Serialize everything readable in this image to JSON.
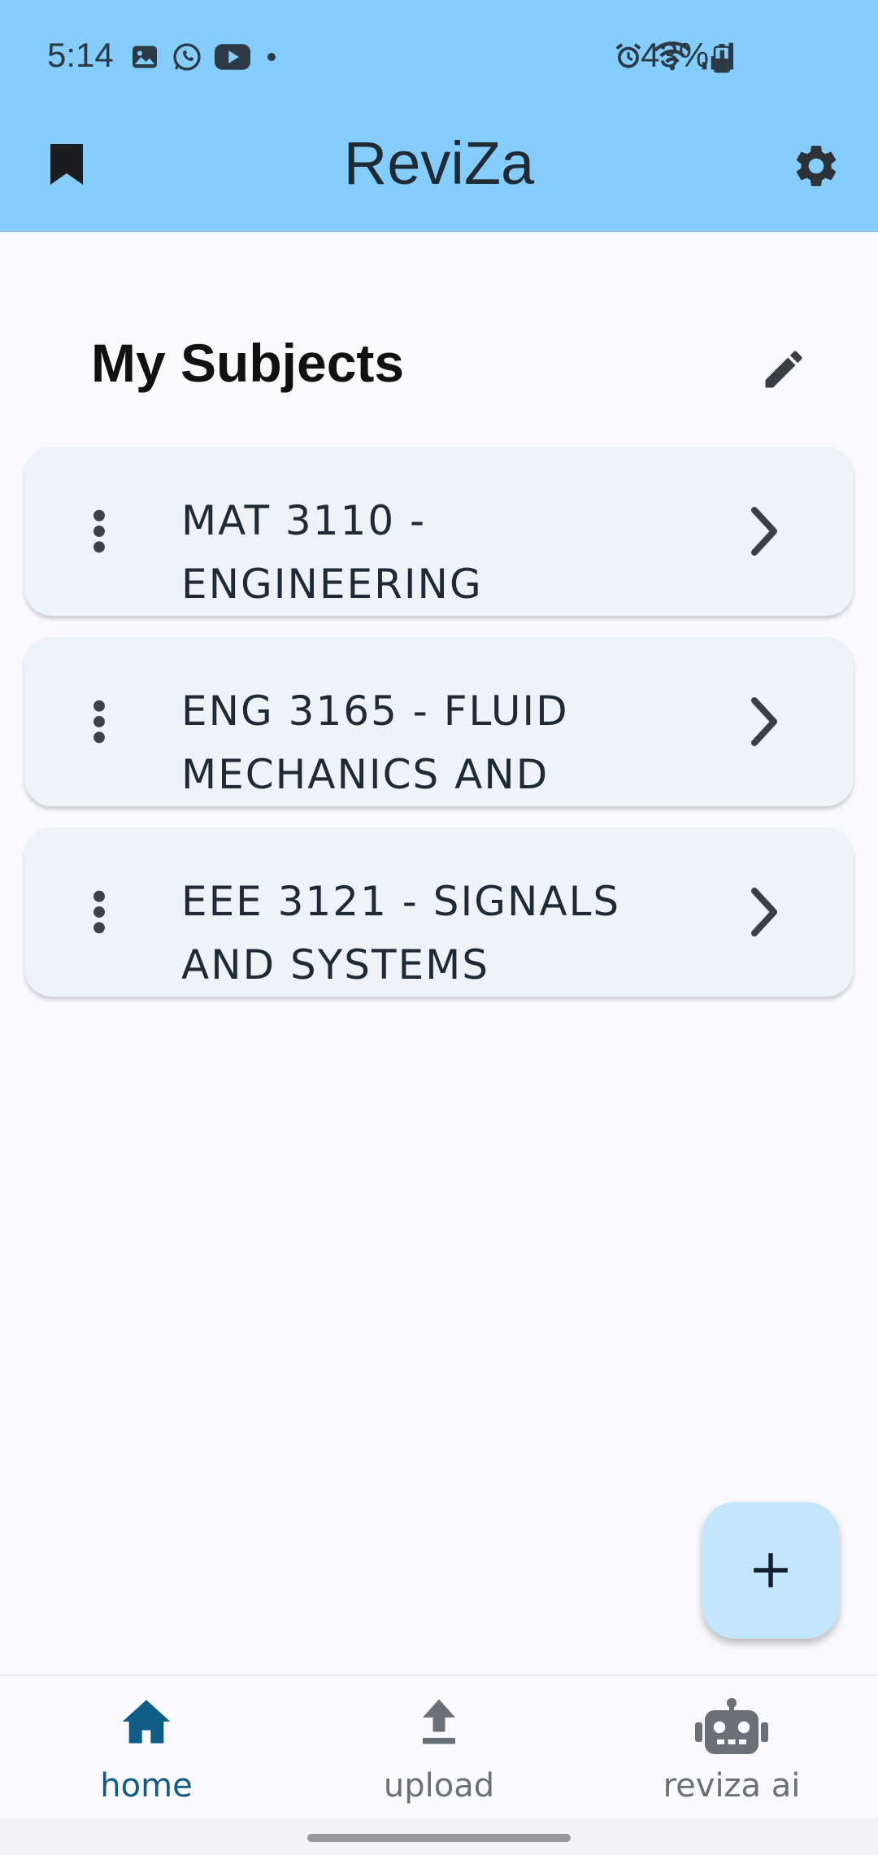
{
  "status_bar": {
    "time": "5:14",
    "battery": "43%",
    "left_icons": [
      "gallery-icon",
      "whatsapp-icon",
      "youtube-icon",
      "dot-icon"
    ],
    "right_icons": [
      "alarm-icon",
      "wifi-icon",
      "signal-icon",
      "battery-icon"
    ]
  },
  "app_bar": {
    "title": "ReviZa",
    "left_icon": "bookmark-icon",
    "right_icon": "gear-icon"
  },
  "section": {
    "title": "My Subjects",
    "edit_icon": "pencil-icon"
  },
  "subjects": [
    {
      "label": "MAT 3110 -\nENGINEERING"
    },
    {
      "label": "ENG 3165 - FLUID\nMECHANICS AND"
    },
    {
      "label": "EEE 3121 - SIGNALS\nAND SYSTEMS"
    }
  ],
  "fab": {
    "icon": "plus-icon"
  },
  "bottom_nav": {
    "items": [
      {
        "label": "home",
        "icon": "home-icon",
        "active": true
      },
      {
        "label": "upload",
        "icon": "upload-icon",
        "active": false
      },
      {
        "label": "reviza ai",
        "icon": "robot-icon",
        "active": false
      }
    ]
  },
  "colors": {
    "app_bar": "#84cdfc",
    "card": "#eef3f8",
    "fab": "#c4e6fd",
    "active_nav": "#0f5c86",
    "inactive_nav": "#6b7076"
  }
}
